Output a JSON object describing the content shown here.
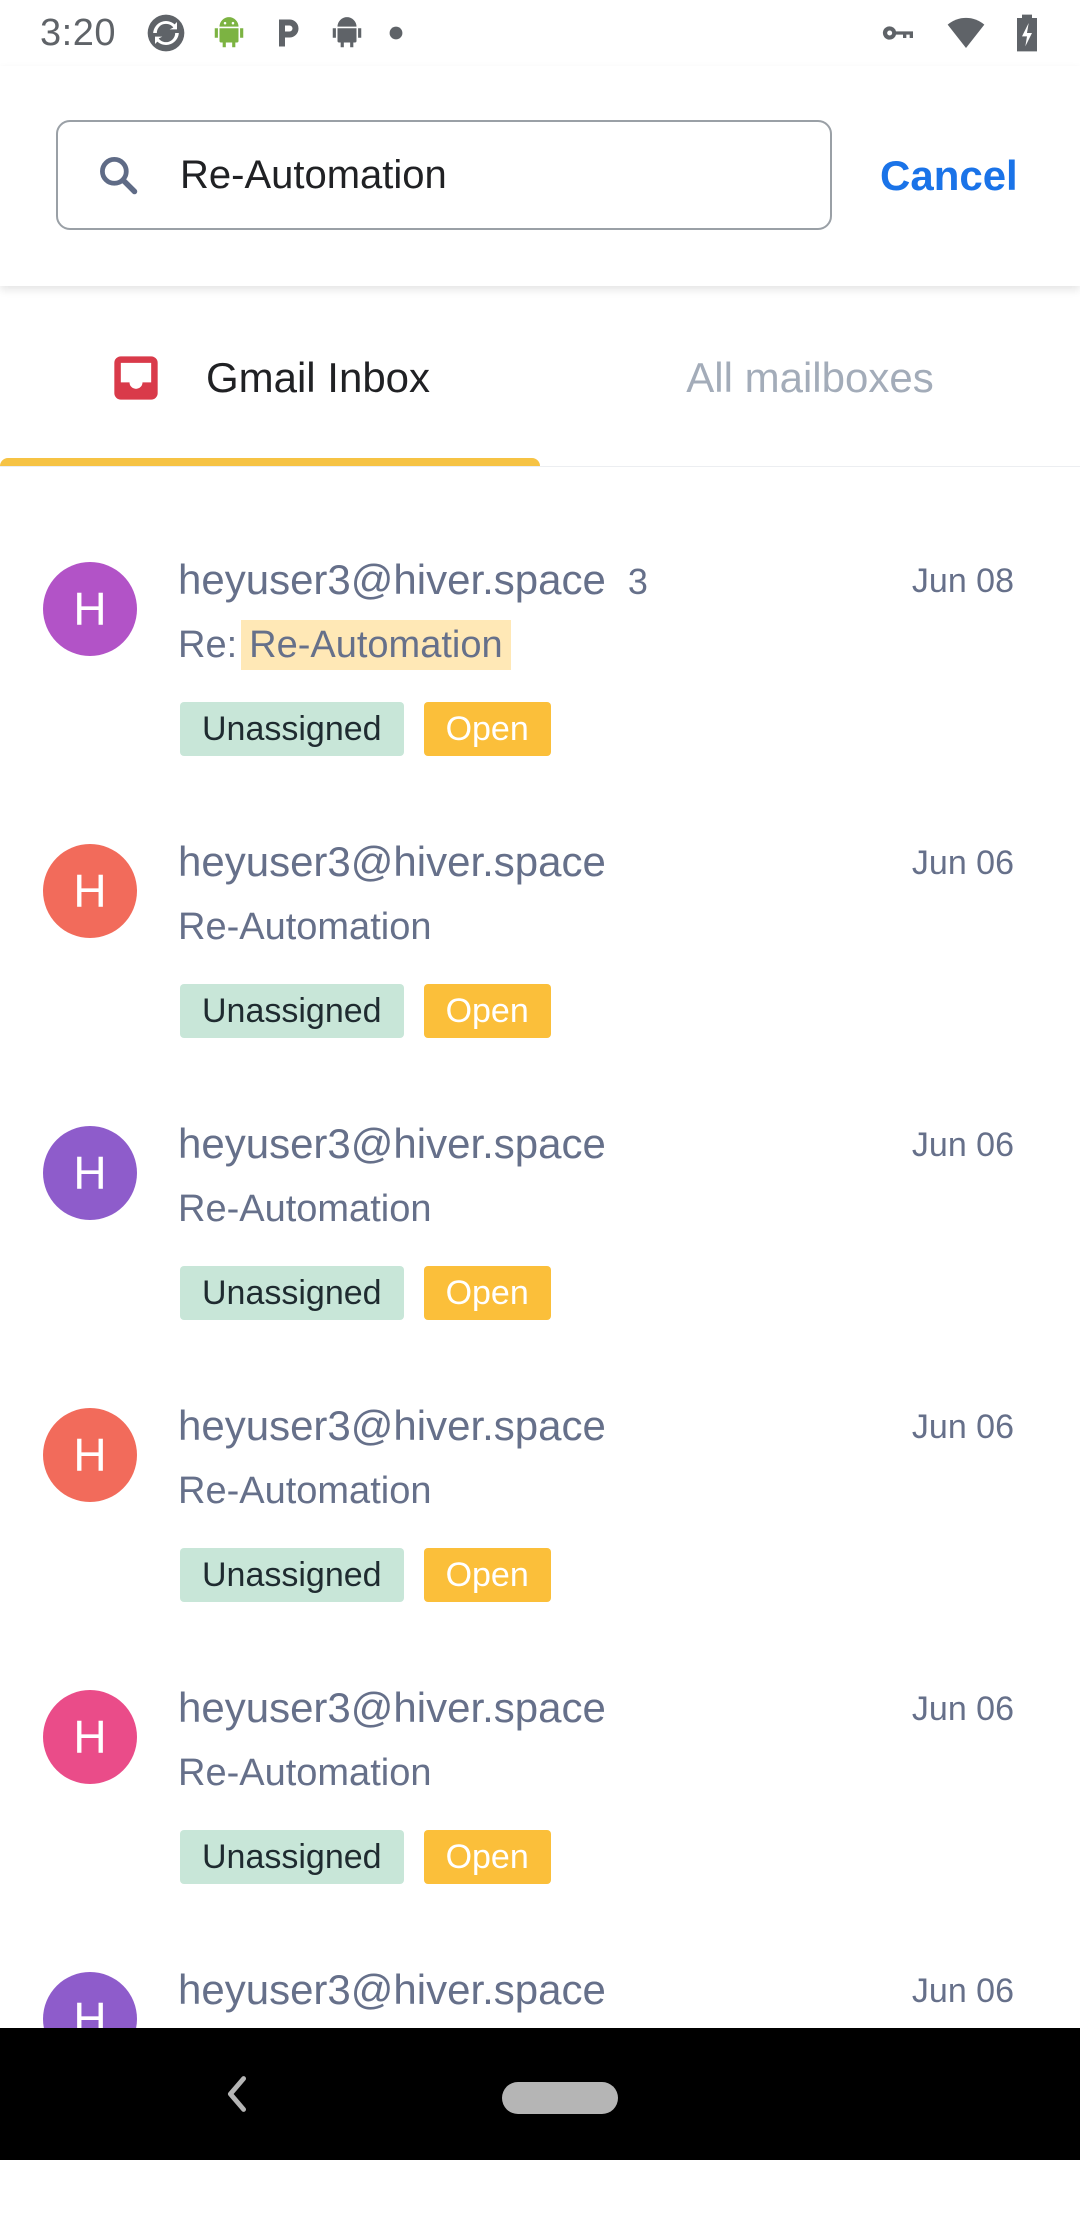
{
  "status_bar": {
    "time": "3:20",
    "icons_left": [
      "sync-icon",
      "android-icon",
      "parking-icon",
      "android-icon",
      "dot-icon"
    ],
    "icons_right": [
      "key-icon",
      "wifi-icon",
      "battery-icon"
    ]
  },
  "search": {
    "value": "Re-Automation",
    "cancel_label": "Cancel"
  },
  "tabs": [
    {
      "label": "Gmail Inbox",
      "active": true,
      "icon": "inbox-icon"
    },
    {
      "label": "All mailboxes",
      "active": false
    }
  ],
  "colors": {
    "accent": "#1a73e8",
    "tab_indicator": "#f6c344",
    "unassigned_bg": "#c8e6d8",
    "open_bg": "#fbbf3a"
  },
  "mails": [
    {
      "avatar_letter": "H",
      "avatar_color": "#b253c7",
      "sender": "heyuser3@hiver.space",
      "count": "3",
      "date": "Jun 08",
      "subject_prefix": "Re:",
      "subject": "Re-Automation",
      "tags": [
        "Unassigned",
        "Open"
      ]
    },
    {
      "avatar_letter": "H",
      "avatar_color": "#f26b5b",
      "sender": "heyuser3@hiver.space",
      "date": "Jun 06",
      "subject": "Re-Automation",
      "tags": [
        "Unassigned",
        "Open"
      ]
    },
    {
      "avatar_letter": "H",
      "avatar_color": "#8e5ccb",
      "sender": "heyuser3@hiver.space",
      "date": "Jun 06",
      "subject": "Re-Automation",
      "tags": [
        "Unassigned",
        "Open"
      ]
    },
    {
      "avatar_letter": "H",
      "avatar_color": "#f26b5b",
      "sender": "heyuser3@hiver.space",
      "date": "Jun 06",
      "subject": "Re-Automation",
      "tags": [
        "Unassigned",
        "Open"
      ]
    },
    {
      "avatar_letter": "H",
      "avatar_color": "#ea4c89",
      "sender": "heyuser3@hiver.space",
      "date": "Jun 06",
      "subject": "Re-Automation",
      "tags": [
        "Unassigned",
        "Open"
      ]
    },
    {
      "avatar_letter": "H",
      "avatar_color": "#8e5ccb",
      "sender": "heyuser3@hiver.space",
      "date": "Jun 06",
      "subject": "",
      "tags": []
    }
  ],
  "nav": {
    "icons": [
      "back-icon",
      "home-pill-icon"
    ]
  }
}
